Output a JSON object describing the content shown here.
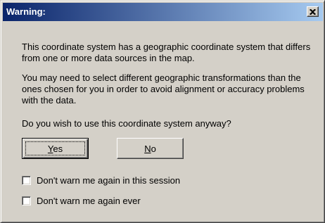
{
  "window": {
    "title": "Warning:",
    "close_glyph": "×"
  },
  "message": {
    "paragraph1": "This coordinate system has a geographic coordinate system that differs from one or more data sources in the map.",
    "paragraph2": "You may need to select different geographic transformations than the ones chosen for you in order to avoid alignment or accuracy problems with the data.",
    "question": "Do you wish to use this coordinate system anyway?"
  },
  "buttons": {
    "yes": {
      "mnemonic": "Y",
      "rest": "es"
    },
    "no": {
      "mnemonic": "N",
      "rest": "o"
    }
  },
  "options": [
    {
      "label": "Don't warn me again in this session",
      "checked": false
    },
    {
      "label": "Don't warn me again ever",
      "checked": false
    }
  ],
  "colors": {
    "face": "#d4d0c8",
    "title_start": "#0a246a",
    "title_end": "#a6caf0",
    "title_text": "#ffffff"
  },
  "icons": {
    "close": "close-icon"
  }
}
